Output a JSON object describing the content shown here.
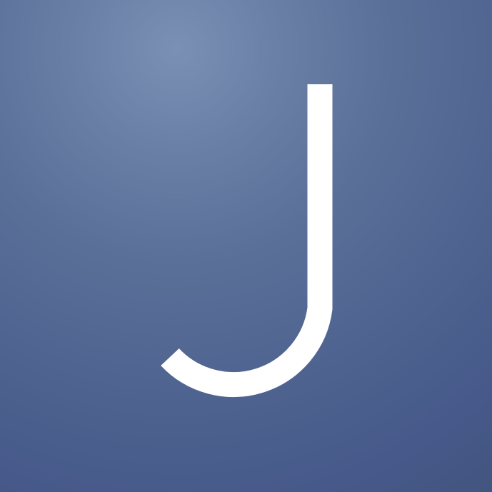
{
  "icon": {
    "name": "letter-j-logo-icon",
    "glyph": "J",
    "background_color_top": "#7a90b4",
    "background_color_bottom": "#42557f",
    "glyph_color": "#ffffff"
  }
}
